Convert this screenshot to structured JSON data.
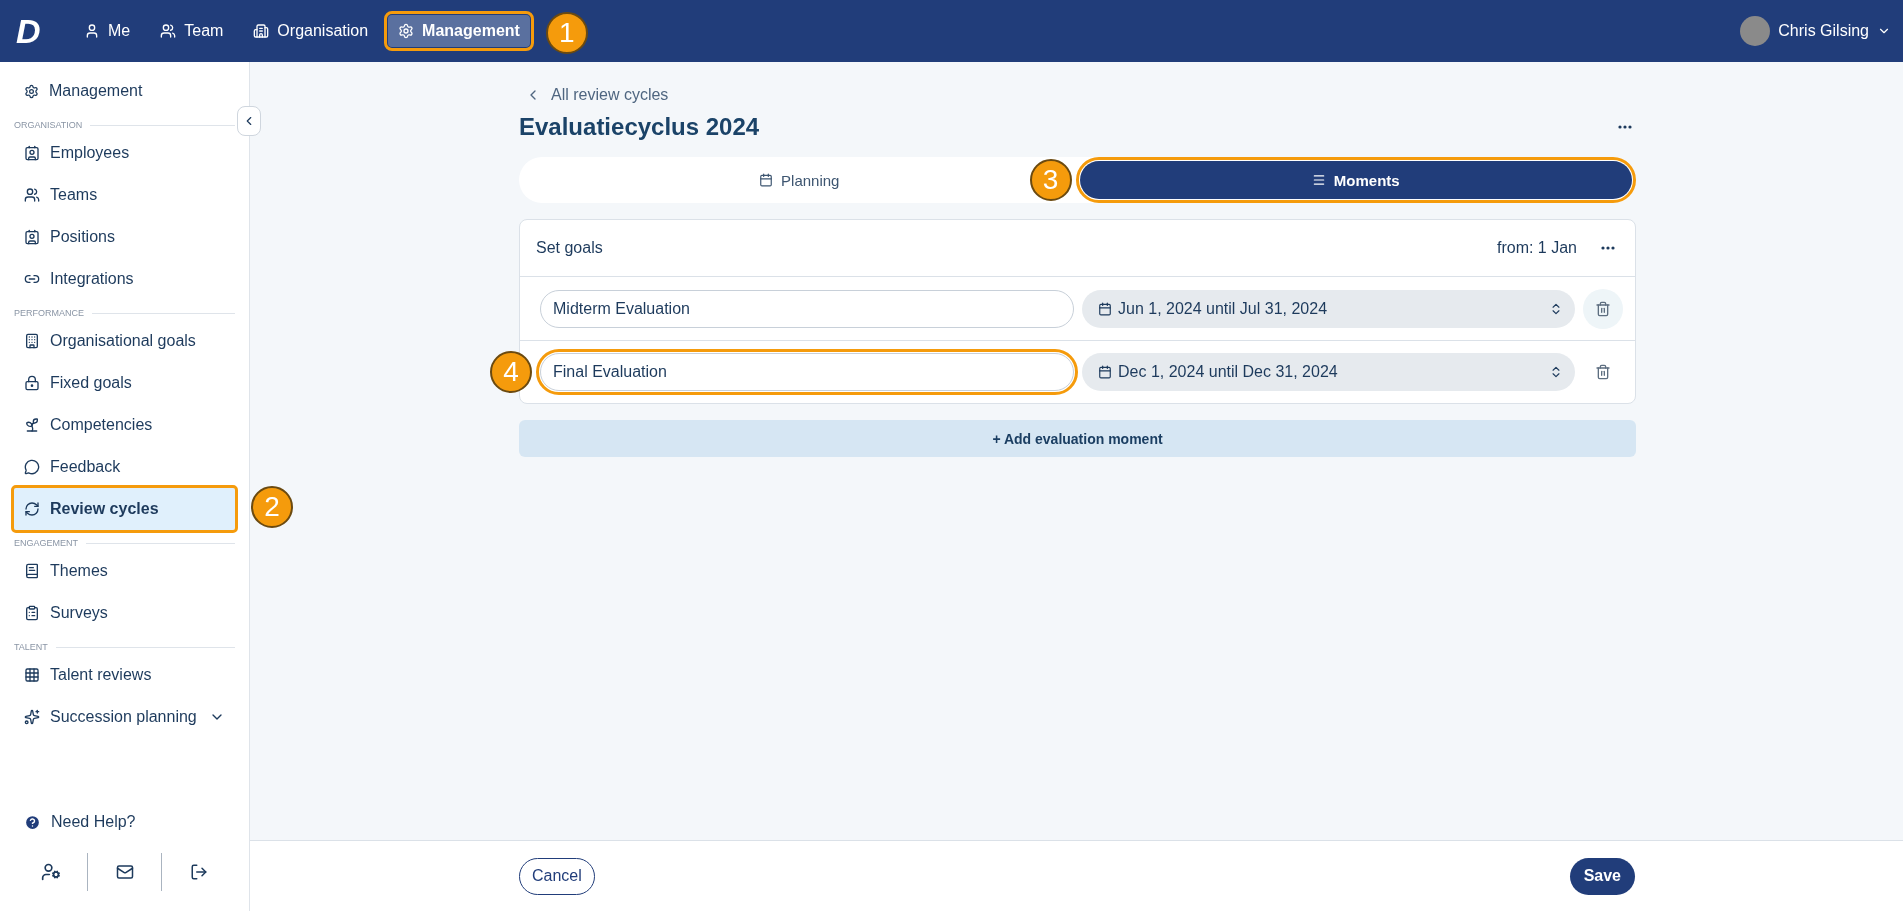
{
  "topbar": {
    "logo": "D",
    "nav": [
      {
        "label": "Me",
        "selected": false
      },
      {
        "label": "Team",
        "selected": false
      },
      {
        "label": "Organisation",
        "selected": false
      },
      {
        "label": "Management",
        "selected": true,
        "callout": "1"
      }
    ],
    "user": {
      "name": "Chris Gilsing"
    }
  },
  "sidebar": {
    "top": {
      "label": "Management",
      "selected": false
    },
    "sections": [
      {
        "title": "ORGANISATION",
        "items": [
          {
            "label": "Employees",
            "selected": false
          },
          {
            "label": "Teams",
            "selected": false
          },
          {
            "label": "Positions",
            "selected": false
          },
          {
            "label": "Integrations",
            "selected": false
          }
        ]
      },
      {
        "title": "PERFORMANCE",
        "items": [
          {
            "label": "Organisational goals",
            "selected": false
          },
          {
            "label": "Fixed goals",
            "selected": false
          },
          {
            "label": "Competencies",
            "selected": false
          },
          {
            "label": "Feedback",
            "selected": false
          },
          {
            "label": "Review cycles",
            "selected": true,
            "callout": "2"
          }
        ]
      },
      {
        "title": "ENGAGEMENT",
        "items": [
          {
            "label": "Themes",
            "selected": false
          },
          {
            "label": "Surveys",
            "selected": false
          }
        ]
      },
      {
        "title": "TALENT",
        "items": [
          {
            "label": "Talent reviews",
            "selected": false
          },
          {
            "label": "Succession planning",
            "selected": false,
            "expanded": false
          }
        ]
      }
    ],
    "help": "Need Help?"
  },
  "main": {
    "back": "All review cycles",
    "title": "Evaluatiecyclus 2024",
    "tabs": [
      {
        "label": "Planning",
        "selected": false
      },
      {
        "label": "Moments",
        "selected": true,
        "callout": "3"
      }
    ],
    "card": {
      "title": "Set goals",
      "from": "from: 1 Jan",
      "moments": [
        {
          "name": "Midterm Evaluation",
          "dates": "Jun 1, 2024 until Jul 31, 2024",
          "hovered": true
        },
        {
          "name": "Final Evaluation",
          "dates": "Dec 1, 2024 until Dec 31, 2024",
          "hovered": false,
          "callout": "4"
        }
      ]
    },
    "add": "+ Add evaluation moment"
  },
  "footer": {
    "cancel": "Cancel",
    "save": "Save"
  }
}
